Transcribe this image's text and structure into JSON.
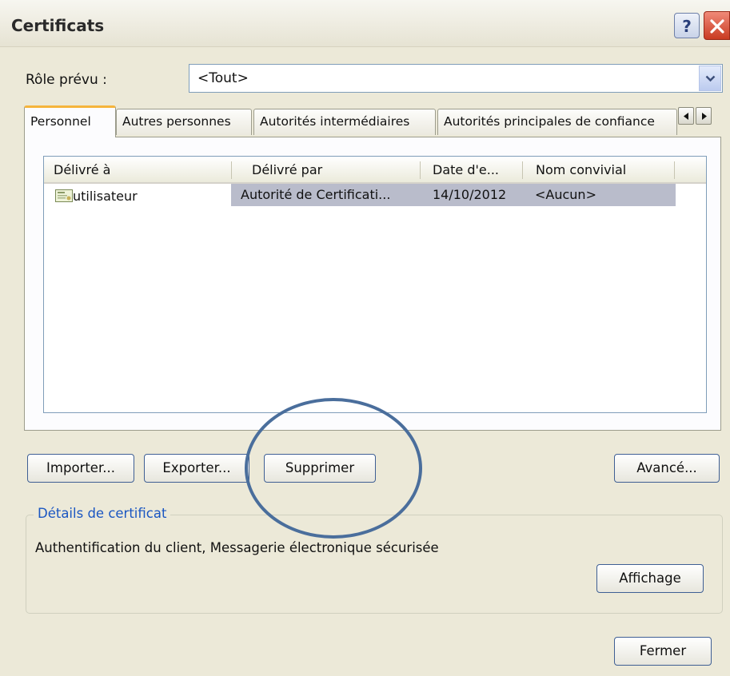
{
  "window": {
    "title": "Certificats"
  },
  "role": {
    "label": "Rôle prévu :",
    "value": "<Tout>"
  },
  "tabs": [
    {
      "label": "Personnel",
      "active": true
    },
    {
      "label": "Autres personnes",
      "active": false
    },
    {
      "label": "Autorités intermédiaires",
      "active": false
    },
    {
      "label": "Autorités principales de confiance",
      "active": false
    }
  ],
  "list": {
    "columns": [
      "Délivré à",
      "Délivré par",
      "Date d'e...",
      "Nom convivial"
    ],
    "rows": [
      {
        "issued_to": "utilisateur",
        "issued_by": "Autorité de Certificati...",
        "date": "14/10/2012",
        "friendly_name": "<Aucun>",
        "selected": true
      }
    ]
  },
  "buttons": {
    "import": "Importer...",
    "export": "Exporter...",
    "delete": "Supprimer",
    "advanced": "Avancé...",
    "view": "Affichage",
    "close": "Fermer"
  },
  "details": {
    "title": "Détails de certificat",
    "text": "Authentification du client, Messagerie électronique sécurisée"
  },
  "colors": {
    "dialog_bg": "#ece9d8",
    "active_tab_accent": "#f5b43c",
    "selected_row": "#b9bccb",
    "group_title": "#1a56c2",
    "annotation_circle": "#4a6e9c"
  }
}
